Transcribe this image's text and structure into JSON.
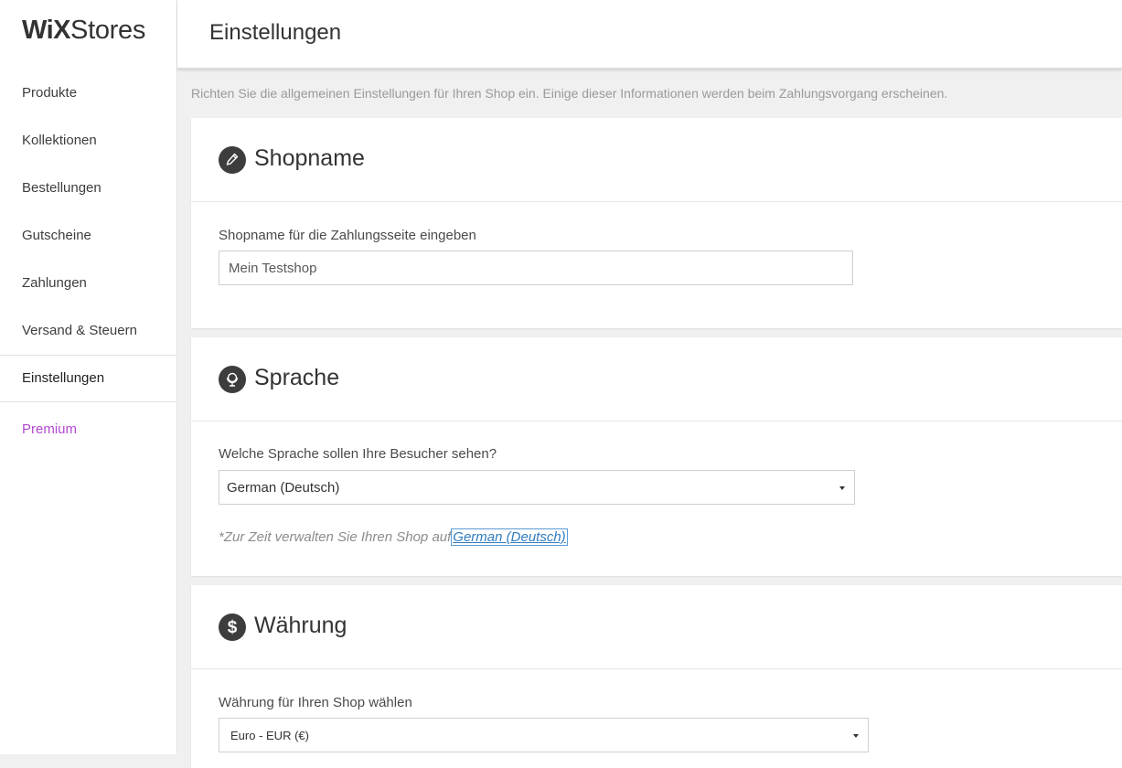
{
  "logo": {
    "bold": "WiX",
    "light": "Stores"
  },
  "sidebar": {
    "items": [
      {
        "label": "Produkte"
      },
      {
        "label": "Kollektionen"
      },
      {
        "label": "Bestellungen"
      },
      {
        "label": "Gutscheine"
      },
      {
        "label": "Zahlungen"
      },
      {
        "label": "Versand & Steuern"
      },
      {
        "label": "Einstellungen"
      },
      {
        "label": "Premium"
      }
    ]
  },
  "header": {
    "title": "Einstellungen"
  },
  "intro": "Richten Sie die allgemeinen Einstellungen für Ihren Shop ein. Einige dieser Informationen werden beim Zahlungsvorgang erscheinen.",
  "shopname": {
    "title": "Shopname",
    "icon": "pencil-icon",
    "label": "Shopname für die Zahlungsseite eingeben",
    "value": "Mein Testshop"
  },
  "language": {
    "title": "Sprache",
    "icon": "globe-icon",
    "label": "Welche Sprache sollen Ihre Besucher sehen?",
    "selected": "German (Deutsch)",
    "note_prefix": "*Zur Zeit verwalten Sie Ihren Shop auf",
    "note_link": "German (Deutsch)"
  },
  "currency": {
    "title": "Währung",
    "icon": "dollar-icon",
    "label": "Währung für Ihren Shop wählen",
    "selected": "Euro - EUR (€)"
  },
  "colors": {
    "premium": "#b14ad0",
    "link": "#2f7bbf",
    "icon_bg": "#3d3d3d"
  }
}
